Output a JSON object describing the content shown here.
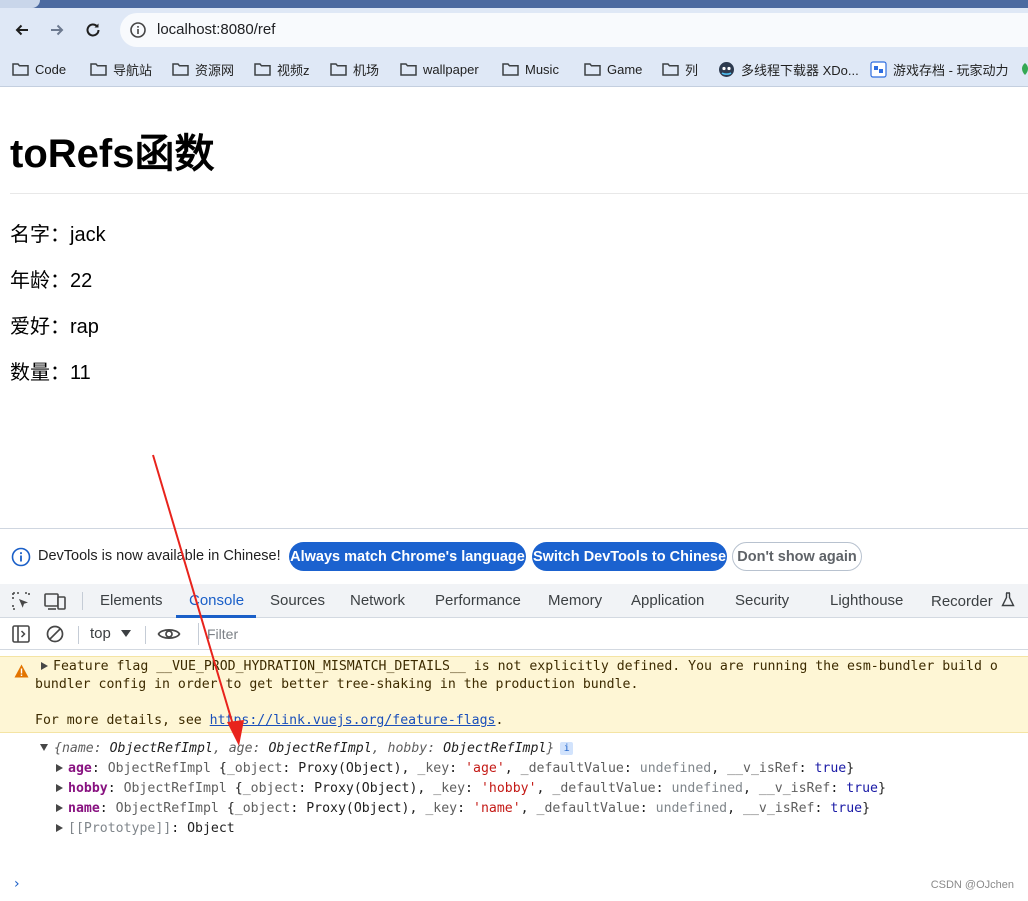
{
  "browser": {
    "url": "localhost:8080/ref",
    "bookmarks": [
      {
        "label": "Code",
        "icon": "folder-icon"
      },
      {
        "label": "导航站",
        "icon": "folder-icon"
      },
      {
        "label": "资源网",
        "icon": "folder-icon"
      },
      {
        "label": "视频z",
        "icon": "folder-icon"
      },
      {
        "label": "机场",
        "icon": "folder-icon"
      },
      {
        "label": "wallpaper",
        "icon": "folder-icon"
      },
      {
        "label": "Music",
        "icon": "folder-icon"
      },
      {
        "label": "Game",
        "icon": "folder-icon"
      },
      {
        "label": "列",
        "icon": "folder-icon"
      },
      {
        "label": "多线程下载器 XDo...",
        "icon": "xdown-favicon"
      },
      {
        "label": "游戏存档 - 玩家动力",
        "icon": "game-favicon"
      }
    ]
  },
  "page": {
    "title": "toRefs函数",
    "fields": [
      {
        "label": "名字",
        "value": "jack"
      },
      {
        "label": "年龄",
        "value": "22"
      },
      {
        "label": "爱好",
        "value": "rap"
      },
      {
        "label": "数量",
        "value": "11"
      }
    ],
    "separator": "："
  },
  "devtools": {
    "infobar": {
      "text": "DevTools is now available in Chinese!",
      "match_btn": "Always match Chrome's language",
      "switch_btn": "Switch DevTools to Chinese",
      "dismiss_btn": "Don't show again"
    },
    "tabs": [
      "Elements",
      "Console",
      "Sources",
      "Network",
      "Performance",
      "Memory",
      "Application",
      "Security",
      "Lighthouse",
      "Recorder"
    ],
    "active_tab": "Console",
    "context": "top",
    "filter_placeholder": "Filter",
    "warning": {
      "line1": "Feature flag __VUE_PROD_HYDRATION_MISMATCH_DETAILS__ is not explicitly defined. You are running the esm-bundler build o",
      "line2": "bundler config in order to get better tree-shaking in the production bundle.",
      "line3_prefix": "For more details, see ",
      "link": "https://link.vuejs.org/feature-flags",
      "line3_suffix": "."
    },
    "object_log": {
      "summary": [
        {
          "key": "name",
          "type": "ObjectRefImpl"
        },
        {
          "key": "age",
          "type": "ObjectRefImpl"
        },
        {
          "key": "hobby",
          "type": "ObjectRefImpl"
        }
      ],
      "entries": [
        {
          "key": "age",
          "type": "ObjectRefImpl",
          "object": "Proxy(Object)",
          "keyval": "'age'",
          "default": "undefined",
          "isref": "true"
        },
        {
          "key": "hobby",
          "type": "ObjectRefImpl",
          "object": "Proxy(Object)",
          "keyval": "'hobby'",
          "default": "undefined",
          "isref": "true"
        },
        {
          "key": "name",
          "type": "ObjectRefImpl",
          "object": "Proxy(Object)",
          "keyval": "'name'",
          "default": "undefined",
          "isref": "true"
        }
      ],
      "prototype_label": "[[Prototype]]",
      "prototype_value": "Object"
    },
    "prompt": "›"
  },
  "watermark": "CSDN @OJchen",
  "colors": {
    "accent": "#1a5fc8",
    "warning_bg": "#fef6d5",
    "arrow": "#e8231c"
  }
}
